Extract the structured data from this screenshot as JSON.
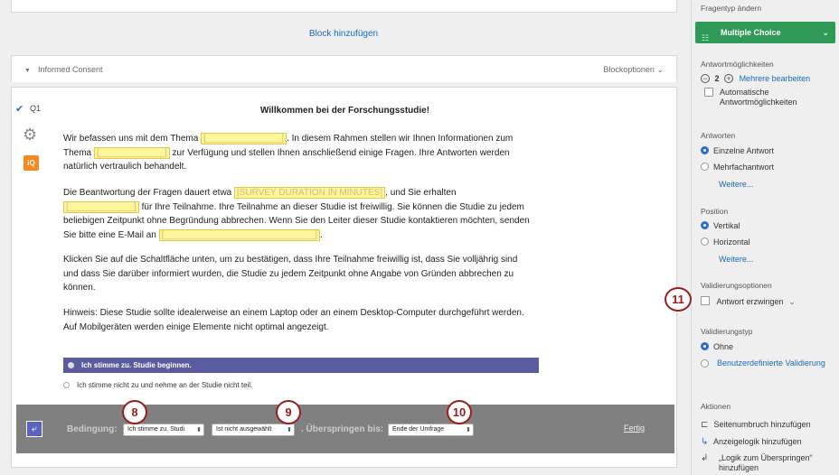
{
  "editor": {
    "block_add": "Block hinzufügen",
    "block": {
      "title": "Informed Consent",
      "options": "Blockoptionen"
    },
    "question": {
      "number": "Q1",
      "heading": "Willkommen bei der Forschungsstudie!",
      "p1_a": "Wir befassen uns mit dem Thema ",
      "p1_b": ". In diesem Rahmen stellen wir Ihnen Informationen zum Thema ",
      "p1_c": " zur Verfügung und stellen Ihnen anschließend einige Fragen. Ihre Antworten werden natürlich vertraulich behandelt.",
      "p2_a": "Die Beantwortung der Fragen dauert etwa ",
      "p2_hl": "[SURVEY DURATION IN MINUTES]",
      "p2_b": ", und Sie erhalten ",
      "p2_c": " für Ihre Teilnahme. Ihre Teilnahme an dieser Studie ist freiwillig. Sie können die Studie zu jedem beliebigen Zeitpunkt ohne Begründung abbrechen. Wenn Sie den Leiter dieser Studie kontaktieren möchten, senden Sie bitte eine E-Mail an ",
      "p3": "Klicken Sie auf die Schaltfläche unten, um zu bestätigen, dass Ihre Teilnahme freiwillig ist, dass Sie volljährig sind und dass Sie darüber informiert wurden, die Studie zu jedem Zeitpunkt ohne Angabe von Gründen abbrechen zu können.",
      "p4": "Hinweis: Diese Studie sollte idealerweise an einem Laptop oder an einem Desktop-Computer durchgeführt werden.  Auf Mobilgeräten werden einige Elemente nicht optimal angezeigt.",
      "choices": [
        "Ich stimme zu. Studie beginnen.",
        "Ich stimme nicht zu und nehme an der Studie nicht teil."
      ]
    },
    "logic": {
      "condition_label": "Bedingung:",
      "choice_select": "Ich stimme zu. Studi",
      "state_select": "Ist nicht ausgewählt",
      "skip_label": ". Überspringen bis:",
      "target_select": "Ende der Umfrage",
      "done": "Fertig"
    },
    "markers": [
      "8",
      "9",
      "10",
      "11"
    ]
  },
  "panel": {
    "question_type_label": "Fragentyp ändern",
    "question_type": "Multiple Choice",
    "choices_count_label": "Antwortmöglichkeiten",
    "choices_count": "2",
    "edit_multiple": "Mehrere bearbeiten",
    "auto_choices": "Automatische Antwortmöglichkeiten",
    "answers_label": "Antworten",
    "answers_options": [
      "Einzelne Antwort",
      "Mehrfachantwort"
    ],
    "more": "Weitere...",
    "position_label": "Position",
    "position_options": [
      "Vertikal",
      "Horizontal"
    ],
    "validation_options_label": "Validierungsoptionen",
    "force_response": "Antwort erzwingen",
    "validation_type_label": "Validierungstyp",
    "validation_type_options": [
      "Ohne",
      "Benutzerdefinierte Validierung"
    ],
    "actions_label": "Aktionen",
    "actions": [
      "Seitenumbruch hinzufügen",
      "Anzeigelogik hinzufügen",
      "„Logik zum Überspringen“ hinzufügen"
    ]
  },
  "colors": {
    "accent": "#2f9a58",
    "link": "#1a6bb8",
    "selected_choice": "#5b5ba0",
    "marker": "#9b1c1c"
  },
  "icons": [
    "chevron-up-icon",
    "triangle-down-icon",
    "chevron-down-icon",
    "checkbox-icon",
    "gear-icon",
    "iq-icon",
    "skip-logic-icon",
    "list-icon",
    "minus-icon",
    "plus-icon",
    "page-break-icon",
    "display-logic-icon",
    "skip-arrow-icon"
  ]
}
